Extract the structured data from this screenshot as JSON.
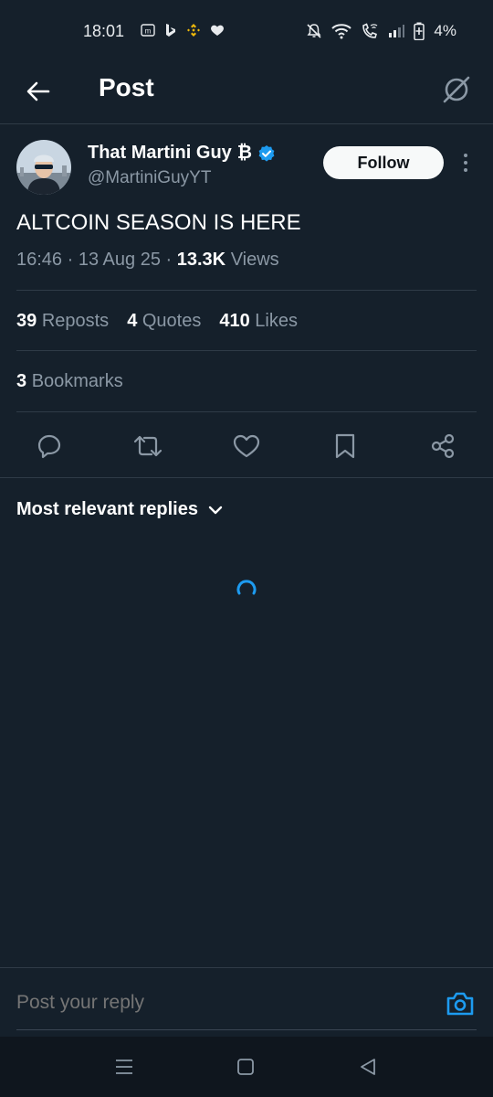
{
  "status_bar": {
    "time": "18:01",
    "battery": "4%",
    "left_icons": [
      "messenger-icon",
      "bing-icon",
      "binance-icon",
      "heart-icon"
    ],
    "right_icons": [
      "mute-icon",
      "wifi-icon",
      "wifi-call-icon",
      "signal-icon",
      "battery-icon"
    ]
  },
  "header": {
    "title": "Post",
    "back_icon": "arrow-left-icon",
    "grok_icon": "grok-icon"
  },
  "post": {
    "author": {
      "display_name": "That Martini Guy",
      "name_suffix": "₿",
      "verified": true,
      "handle": "@MartiniGuyYT"
    },
    "follow_label": "Follow",
    "text": "ALTCOIN SEASON IS HERE",
    "time": "16:46",
    "sep1": "·",
    "date": "13 Aug 25",
    "sep2": "·",
    "views_count": "13.3K",
    "views_label": "Views",
    "stats": {
      "reposts_count": "39",
      "reposts_label": "Reposts",
      "quotes_count": "4",
      "quotes_label": "Quotes",
      "likes_count": "410",
      "likes_label": "Likes",
      "bookmarks_count": "3",
      "bookmarks_label": "Bookmarks"
    },
    "actions": [
      "reply-icon",
      "repost-icon",
      "like-icon",
      "bookmark-icon",
      "share-icon"
    ]
  },
  "replies": {
    "sort_label": "Most relevant replies"
  },
  "reply_bar": {
    "placeholder": "Post your reply"
  },
  "colors": {
    "background": "#15202b",
    "accent": "#1d9bf0",
    "secondary_text": "#8b98a5",
    "divider": "#2f3b47"
  }
}
